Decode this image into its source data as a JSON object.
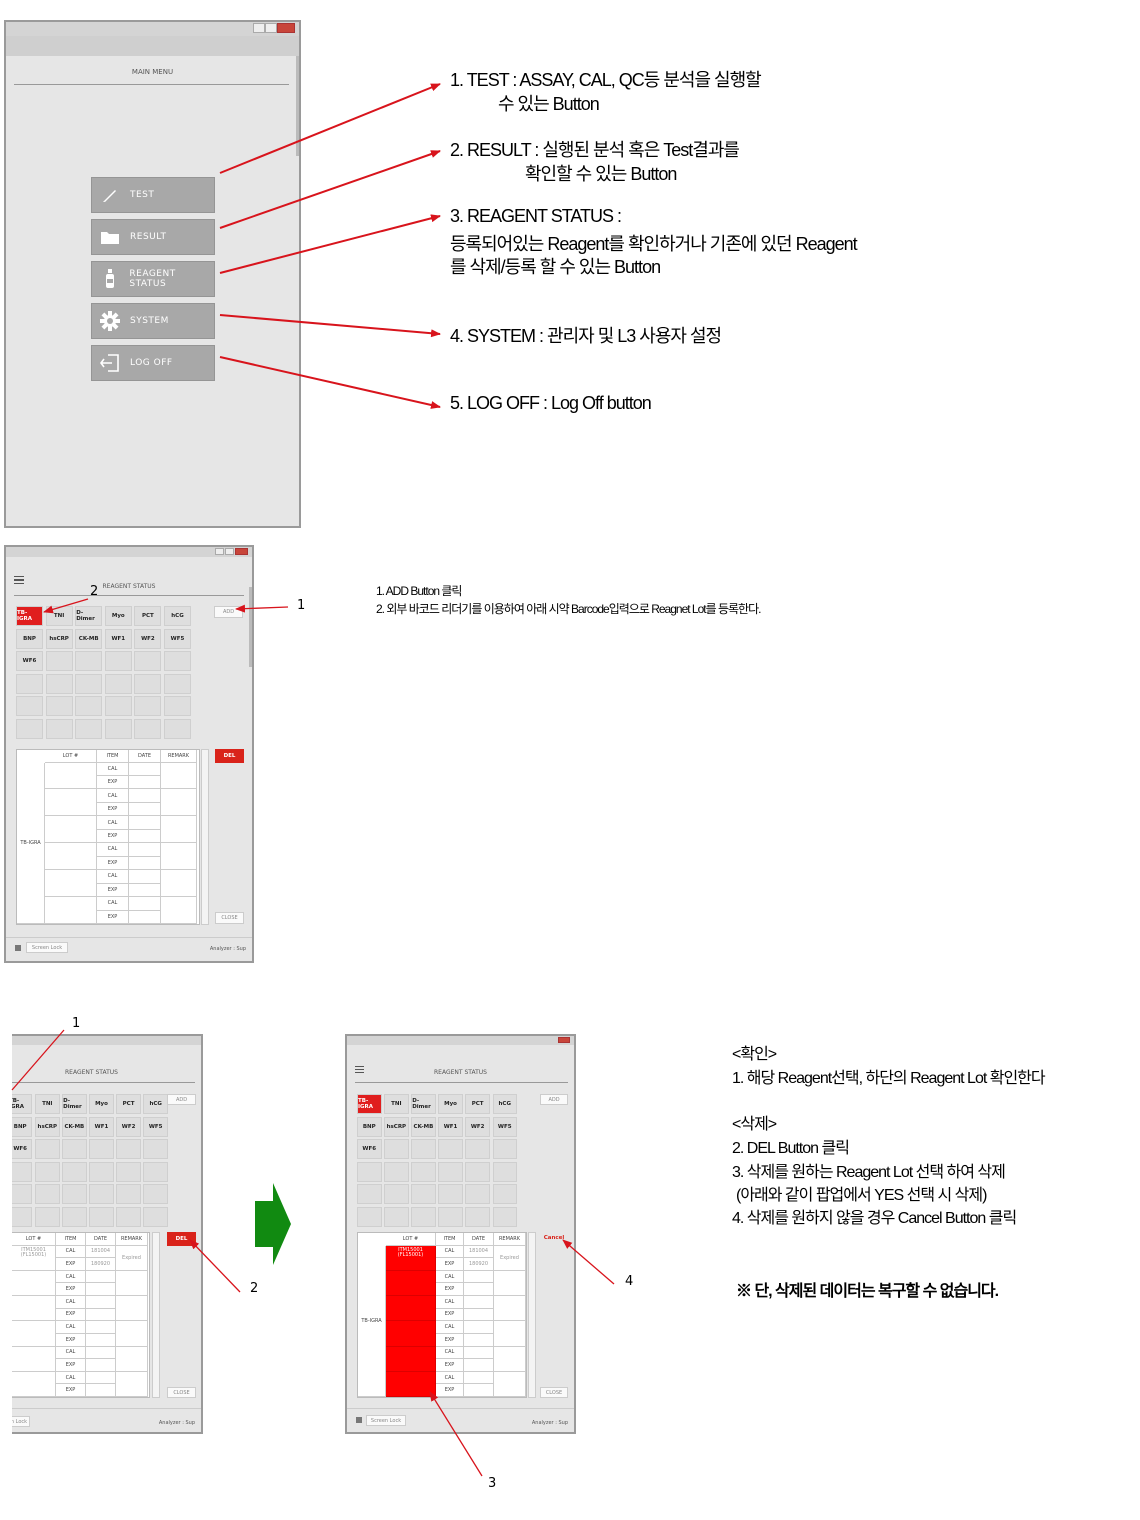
{
  "main_menu": {
    "title": "MAIN MENU",
    "buttons": [
      {
        "label": "TEST",
        "icon": "pen-icon"
      },
      {
        "label": "RESULT",
        "icon": "folder-icon"
      },
      {
        "label": "REAGENT STATUS",
        "icon": "bottle-icon"
      },
      {
        "label": "SYSTEM",
        "icon": "gear-icon"
      },
      {
        "label": "LOG OFF",
        "icon": "logout-icon"
      }
    ]
  },
  "menu_notes": [
    {
      "line1": "1. TEST : ASSAY, CAL, QC등 분석을 실행할",
      "line2": "수 있는 Button"
    },
    {
      "line1": "2. RESULT : 실행된 분석 혹은 Test결과를",
      "line2": "확인할 수 있는 Button"
    },
    {
      "line1": "3. REAGENT STATUS :",
      "line2": "등록되어있는 Reagent를 확인하거나 기존에 있던 Reagent",
      "line3": "를 삭제/등록 할 수 있는 Button"
    },
    {
      "line1": "4. SYSTEM : 관리자 및 L3 사용자 설정"
    },
    {
      "line1": "5. LOG OFF : Log Off button"
    }
  ],
  "reagent_screen": {
    "title": "REAGENT STATUS",
    "items_row1": [
      "TB-IGRA",
      "TNI",
      "D-Dimer",
      "Myo",
      "PCT",
      "hCG"
    ],
    "items_row2": [
      "BNP",
      "hsCRP",
      "CK-MB",
      "WF1",
      "WF2",
      "WF5"
    ],
    "items_row3": [
      "WF6"
    ],
    "add_label": "ADD",
    "del_label": "DEL",
    "cancel_label": "Cancel",
    "close_label": "CLOSE",
    "columns": [
      "LOT #",
      "ITEM",
      "DATE",
      "REMARK"
    ],
    "row_group": "TB-IGRA",
    "items_col": [
      "CAL",
      "EXP",
      "CAL",
      "EXP",
      "CAL",
      "EXP",
      "CAL",
      "EXP",
      "CAL",
      "EXP",
      "CAL",
      "EXP"
    ],
    "screen_lock": "Screen Lock",
    "screen_lock_cut": "n Lock",
    "status_right": "Analyzer : Sup",
    "lot_value1": "ITM15001",
    "lot_value2": "(FL15001)",
    "date_value1": "181004",
    "date_value2": "180920",
    "remark_value": "Expired"
  },
  "reagent_callouts": {
    "one": "1",
    "two": "2",
    "three": "3",
    "four": "4"
  },
  "add_notes": {
    "line1": "1. ADD Button 클릭",
    "line2": "2. 외부 바코드 리더기를 이용하여 아래 시약 Barcode입력으로 Reagnet Lot를 등록한다."
  },
  "delete_notes": {
    "confirm_header": "<확인>",
    "confirm_1": "1. 해당 Reagent선택, 하단의 Reagent Lot 확인한다",
    "delete_header": "<삭제>",
    "delete_2": "2. DEL Button 클릭",
    "delete_3a": "3. 삭제를 원하는 Reagent Lot 선택 하여 삭제",
    "delete_3b": "(아래와 같이 팝업에서 YES 선택 시 삭제)",
    "delete_4": "4. 삭제를 원하지 않을 경우 Cancel Button 클릭",
    "warning": "※ 단, 삭제된 데이터는 복구할 수 없습니다."
  },
  "colors": {
    "red": "#e01e1e",
    "arrow": "#d8141c",
    "green": "#118a11",
    "button_gray": "#a8a8a8"
  }
}
